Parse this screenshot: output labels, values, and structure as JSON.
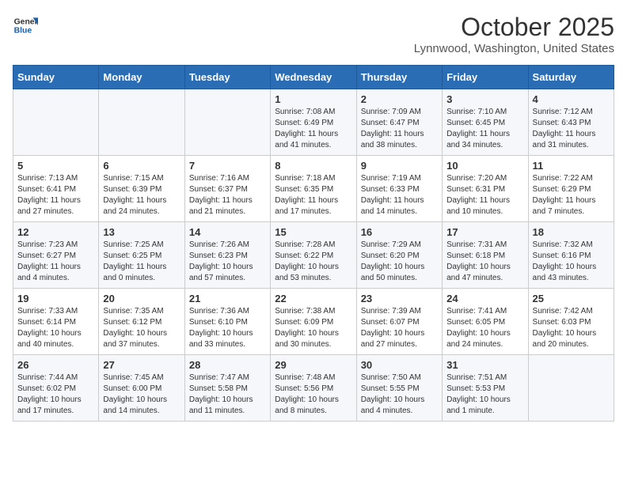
{
  "logo": {
    "line1": "General",
    "line2": "Blue"
  },
  "title": "October 2025",
  "subtitle": "Lynnwood, Washington, United States",
  "days_of_week": [
    "Sunday",
    "Monday",
    "Tuesday",
    "Wednesday",
    "Thursday",
    "Friday",
    "Saturday"
  ],
  "weeks": [
    [
      {
        "day": "",
        "sunrise": "",
        "sunset": "",
        "daylight": ""
      },
      {
        "day": "",
        "sunrise": "",
        "sunset": "",
        "daylight": ""
      },
      {
        "day": "",
        "sunrise": "",
        "sunset": "",
        "daylight": ""
      },
      {
        "day": "1",
        "sunrise": "Sunrise: 7:08 AM",
        "sunset": "Sunset: 6:49 PM",
        "daylight": "Daylight: 11 hours and 41 minutes."
      },
      {
        "day": "2",
        "sunrise": "Sunrise: 7:09 AM",
        "sunset": "Sunset: 6:47 PM",
        "daylight": "Daylight: 11 hours and 38 minutes."
      },
      {
        "day": "3",
        "sunrise": "Sunrise: 7:10 AM",
        "sunset": "Sunset: 6:45 PM",
        "daylight": "Daylight: 11 hours and 34 minutes."
      },
      {
        "day": "4",
        "sunrise": "Sunrise: 7:12 AM",
        "sunset": "Sunset: 6:43 PM",
        "daylight": "Daylight: 11 hours and 31 minutes."
      }
    ],
    [
      {
        "day": "5",
        "sunrise": "Sunrise: 7:13 AM",
        "sunset": "Sunset: 6:41 PM",
        "daylight": "Daylight: 11 hours and 27 minutes."
      },
      {
        "day": "6",
        "sunrise": "Sunrise: 7:15 AM",
        "sunset": "Sunset: 6:39 PM",
        "daylight": "Daylight: 11 hours and 24 minutes."
      },
      {
        "day": "7",
        "sunrise": "Sunrise: 7:16 AM",
        "sunset": "Sunset: 6:37 PM",
        "daylight": "Daylight: 11 hours and 21 minutes."
      },
      {
        "day": "8",
        "sunrise": "Sunrise: 7:18 AM",
        "sunset": "Sunset: 6:35 PM",
        "daylight": "Daylight: 11 hours and 17 minutes."
      },
      {
        "day": "9",
        "sunrise": "Sunrise: 7:19 AM",
        "sunset": "Sunset: 6:33 PM",
        "daylight": "Daylight: 11 hours and 14 minutes."
      },
      {
        "day": "10",
        "sunrise": "Sunrise: 7:20 AM",
        "sunset": "Sunset: 6:31 PM",
        "daylight": "Daylight: 11 hours and 10 minutes."
      },
      {
        "day": "11",
        "sunrise": "Sunrise: 7:22 AM",
        "sunset": "Sunset: 6:29 PM",
        "daylight": "Daylight: 11 hours and 7 minutes."
      }
    ],
    [
      {
        "day": "12",
        "sunrise": "Sunrise: 7:23 AM",
        "sunset": "Sunset: 6:27 PM",
        "daylight": "Daylight: 11 hours and 4 minutes."
      },
      {
        "day": "13",
        "sunrise": "Sunrise: 7:25 AM",
        "sunset": "Sunset: 6:25 PM",
        "daylight": "Daylight: 11 hours and 0 minutes."
      },
      {
        "day": "14",
        "sunrise": "Sunrise: 7:26 AM",
        "sunset": "Sunset: 6:23 PM",
        "daylight": "Daylight: 10 hours and 57 minutes."
      },
      {
        "day": "15",
        "sunrise": "Sunrise: 7:28 AM",
        "sunset": "Sunset: 6:22 PM",
        "daylight": "Daylight: 10 hours and 53 minutes."
      },
      {
        "day": "16",
        "sunrise": "Sunrise: 7:29 AM",
        "sunset": "Sunset: 6:20 PM",
        "daylight": "Daylight: 10 hours and 50 minutes."
      },
      {
        "day": "17",
        "sunrise": "Sunrise: 7:31 AM",
        "sunset": "Sunset: 6:18 PM",
        "daylight": "Daylight: 10 hours and 47 minutes."
      },
      {
        "day": "18",
        "sunrise": "Sunrise: 7:32 AM",
        "sunset": "Sunset: 6:16 PM",
        "daylight": "Daylight: 10 hours and 43 minutes."
      }
    ],
    [
      {
        "day": "19",
        "sunrise": "Sunrise: 7:33 AM",
        "sunset": "Sunset: 6:14 PM",
        "daylight": "Daylight: 10 hours and 40 minutes."
      },
      {
        "day": "20",
        "sunrise": "Sunrise: 7:35 AM",
        "sunset": "Sunset: 6:12 PM",
        "daylight": "Daylight: 10 hours and 37 minutes."
      },
      {
        "day": "21",
        "sunrise": "Sunrise: 7:36 AM",
        "sunset": "Sunset: 6:10 PM",
        "daylight": "Daylight: 10 hours and 33 minutes."
      },
      {
        "day": "22",
        "sunrise": "Sunrise: 7:38 AM",
        "sunset": "Sunset: 6:09 PM",
        "daylight": "Daylight: 10 hours and 30 minutes."
      },
      {
        "day": "23",
        "sunrise": "Sunrise: 7:39 AM",
        "sunset": "Sunset: 6:07 PM",
        "daylight": "Daylight: 10 hours and 27 minutes."
      },
      {
        "day": "24",
        "sunrise": "Sunrise: 7:41 AM",
        "sunset": "Sunset: 6:05 PM",
        "daylight": "Daylight: 10 hours and 24 minutes."
      },
      {
        "day": "25",
        "sunrise": "Sunrise: 7:42 AM",
        "sunset": "Sunset: 6:03 PM",
        "daylight": "Daylight: 10 hours and 20 minutes."
      }
    ],
    [
      {
        "day": "26",
        "sunrise": "Sunrise: 7:44 AM",
        "sunset": "Sunset: 6:02 PM",
        "daylight": "Daylight: 10 hours and 17 minutes."
      },
      {
        "day": "27",
        "sunrise": "Sunrise: 7:45 AM",
        "sunset": "Sunset: 6:00 PM",
        "daylight": "Daylight: 10 hours and 14 minutes."
      },
      {
        "day": "28",
        "sunrise": "Sunrise: 7:47 AM",
        "sunset": "Sunset: 5:58 PM",
        "daylight": "Daylight: 10 hours and 11 minutes."
      },
      {
        "day": "29",
        "sunrise": "Sunrise: 7:48 AM",
        "sunset": "Sunset: 5:56 PM",
        "daylight": "Daylight: 10 hours and 8 minutes."
      },
      {
        "day": "30",
        "sunrise": "Sunrise: 7:50 AM",
        "sunset": "Sunset: 5:55 PM",
        "daylight": "Daylight: 10 hours and 4 minutes."
      },
      {
        "day": "31",
        "sunrise": "Sunrise: 7:51 AM",
        "sunset": "Sunset: 5:53 PM",
        "daylight": "Daylight: 10 hours and 1 minute."
      },
      {
        "day": "",
        "sunrise": "",
        "sunset": "",
        "daylight": ""
      }
    ]
  ]
}
